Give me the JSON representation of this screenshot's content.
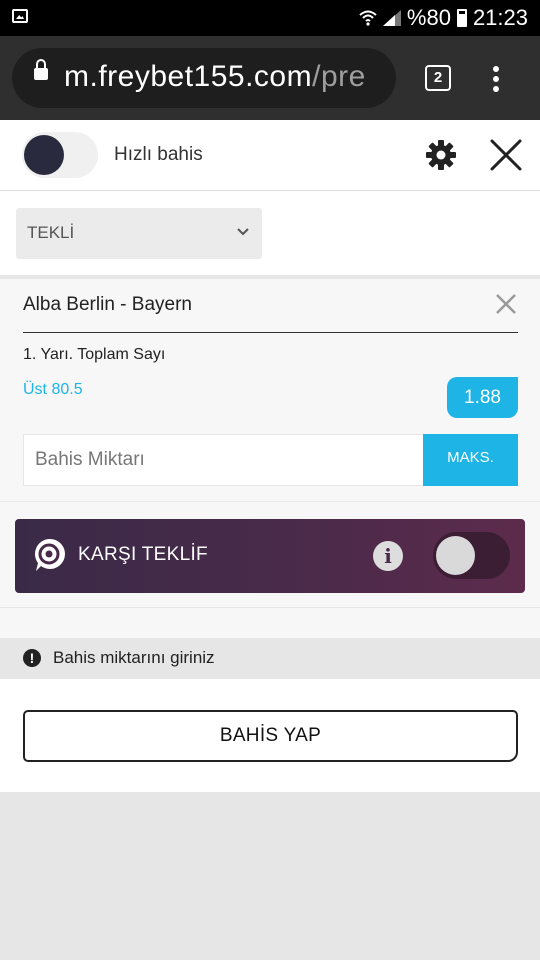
{
  "status_bar": {
    "battery_text": "%80",
    "time": "21:23",
    "icons": [
      "image-icon",
      "wifi-icon",
      "signal-icon",
      "battery-icon"
    ]
  },
  "browser": {
    "url_host": "m.freybet155.com",
    "url_path": "/pre",
    "tab_count": "2"
  },
  "header": {
    "quick_bet_label": "Hızlı bahis",
    "quick_bet_enabled": false
  },
  "bet_type": {
    "selected": "TEKLİ"
  },
  "bet": {
    "match": "Alba Berlin - Bayern",
    "market": "1. Yarı. Toplam Sayı",
    "selection": "Üst 80.5",
    "odds": "1.88",
    "amount_placeholder": "Bahis Miktarı",
    "amount_value": "",
    "max_label": "MAKS."
  },
  "counter_offer": {
    "label": "KARŞI TEKLİF",
    "enabled": false
  },
  "warning": {
    "text": "Bahis miktarını giriniz"
  },
  "actions": {
    "place_bet_label": "BAHİS YAP"
  },
  "colors": {
    "accent": "#1eb4e6",
    "counter_bg_start": "#3a2a48",
    "counter_bg_end": "#5d2b4c",
    "dark": "#2a2a3e"
  }
}
